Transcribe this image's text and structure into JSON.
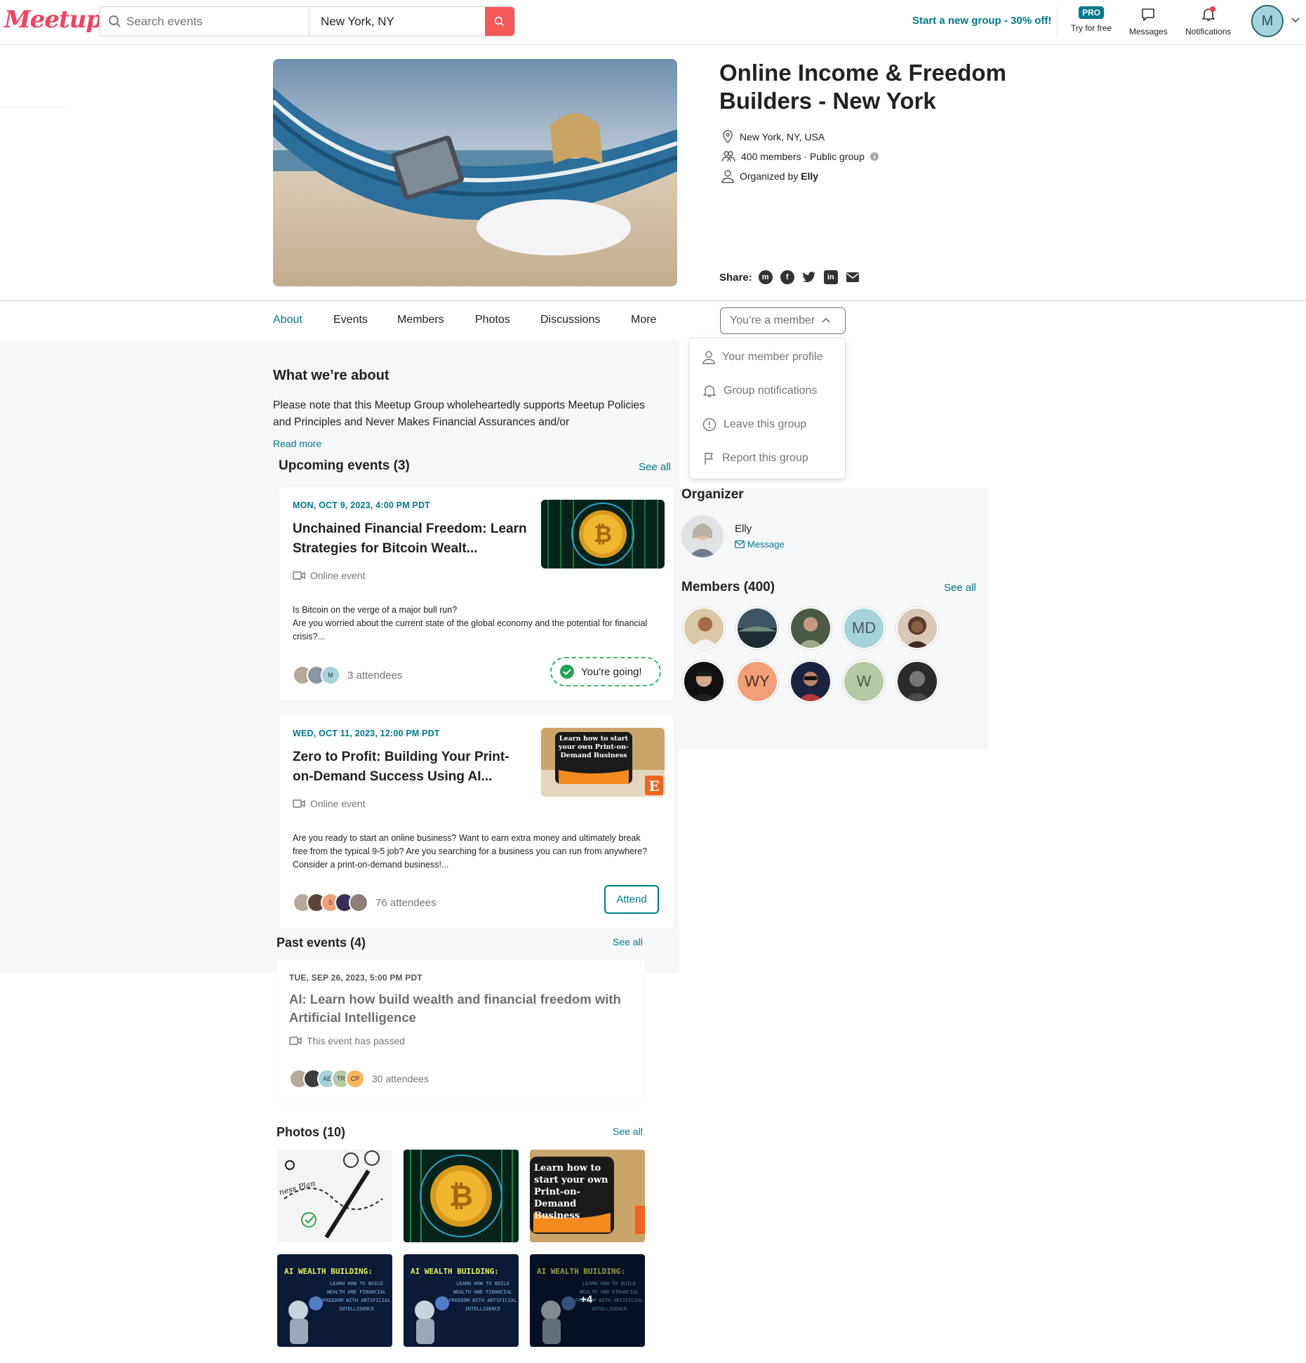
{
  "header": {
    "logo_text": "Meetup",
    "search_placeholder": "Search events",
    "location_value": "New York, NY",
    "promo_text": "Start a new group - 30% off!",
    "pro_badge": "PRO",
    "pro_label": "Try for free",
    "messages_label": "Messages",
    "notifications_label": "Notifications",
    "avatar_initial": "M"
  },
  "group": {
    "title": "Online Income & Freedom Builders - New York",
    "location": "New York, NY, USA",
    "members_info": "400 members · Public group",
    "organized_prefix": "Organized by ",
    "organizer_name": "Elly",
    "share_label": "Share:"
  },
  "tabs": [
    {
      "label": "About"
    },
    {
      "label": "Events"
    },
    {
      "label": "Members"
    },
    {
      "label": "Photos"
    },
    {
      "label": "Discussions"
    },
    {
      "label": "More"
    }
  ],
  "member_button": "You’re a member",
  "dropdown": {
    "items": [
      {
        "label": "Your member profile"
      },
      {
        "label": "Group notifications"
      },
      {
        "label": "Leave this group"
      },
      {
        "label": "Report this group"
      }
    ]
  },
  "about": {
    "heading": "What we’re about",
    "text": "Please note that this Meetup Group wholeheartedly supports Meetup Policies and Principles and Never Makes Financial Assurances and/or",
    "read_more": "Read more"
  },
  "upcoming": {
    "heading": "Upcoming events (3)",
    "see_all": "See all",
    "events": [
      {
        "date": "MON, OCT 9, 2023, 4:00 PM PDT",
        "title": "Unchained Financial Freedom: Learn Strategies for Bitcoin Wealt...",
        "type": "Online event",
        "desc": "Is Bitcoin on the verge of a major bull run?\nAre you worried about the current state of the global economy and the potential for financial crisis?...",
        "attendees": "3 attendees",
        "action": "You're going!"
      },
      {
        "date": "WED, OCT 11, 2023, 12:00 PM PDT",
        "title": "Zero to Profit: Building Your Print-on-Demand Success Using AI...",
        "type": "Online event",
        "desc": "Are you ready to start an online business? Want to earn extra money and ultimately break free from the typical 9-5 job? Are you searching for a business you can run from anywhere? Consider a print-on-demand business!...",
        "attendees": "76 attendees",
        "action": "Attend",
        "thumb_text": "Learn how to start your own Print-on-Demand Business"
      }
    ]
  },
  "past": {
    "heading": "Past events (4)",
    "see_all": "See all",
    "event": {
      "date": "TUE, SEP 26, 2023, 5:00 PM PDT",
      "title": "AI: Learn how build wealth and financial freedom with Artificial Intelligence",
      "status": "This event has passed",
      "attendees": "30 attendees",
      "initials": [
        "AE",
        "TR",
        "CP"
      ]
    }
  },
  "photos": {
    "heading": "Photos (10)",
    "see_all": "See all",
    "pod_text": "Learn how to start your own Print-on-Demand Business",
    "ai_title": "AI WEALTH BUILDING:",
    "ai_sub": "LEARN HOW TO BUILD WEALTH AND FINANCIAL FREEDOM WITH ARTIFICIAL INTELLIGENCE",
    "more_count": "+4",
    "plan_text": "ness Plan"
  },
  "organizer": {
    "heading": "Organizer",
    "name": "Elly",
    "message": "Message"
  },
  "members": {
    "heading": "Members (400)",
    "see_all": "See all",
    "initials": [
      "MD",
      "WY",
      "W"
    ]
  },
  "colors": {
    "brand": "#f64060",
    "teal": "#00798a",
    "search_button": "#f65858",
    "going_green": "#36b86a"
  }
}
